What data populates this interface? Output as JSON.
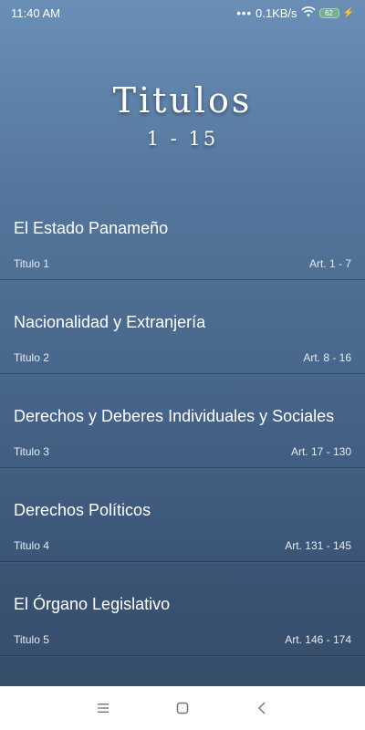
{
  "status_bar": {
    "time": "11:40 AM",
    "network_speed": "0.1KB/s",
    "battery_level": "62",
    "icons": [
      "dots-icon",
      "wifi-icon",
      "battery-icon",
      "charging-bolt-icon"
    ]
  },
  "header": {
    "title": "Titulos",
    "range": "1 - 15"
  },
  "titles": [
    {
      "name": "El Estado Panameño",
      "label": "Titulo 1",
      "articles": "Art. 1 - 7"
    },
    {
      "name": "Nacionalidad y Extranjería",
      "label": "Titulo 2",
      "articles": "Art. 8 - 16"
    },
    {
      "name": "Derechos y Deberes Individuales y Sociales",
      "label": "Titulo 3",
      "articles": "Art. 17 - 130"
    },
    {
      "name": "Derechos Políticos",
      "label": "Titulo 4",
      "articles": "Art. 131 - 145"
    },
    {
      "name": "El Órgano Legislativo",
      "label": "Titulo 5",
      "articles": "Art. 146 - 174"
    }
  ],
  "nav_bar": {
    "icons": [
      "menu-icon",
      "home-square-icon",
      "back-chevron-icon"
    ]
  },
  "colors": {
    "background_top": "#6a8fb7",
    "background_bottom": "#354b66",
    "text": "#ffffff",
    "nav_background": "#ffffff",
    "battery_accent": "#9be36b"
  }
}
